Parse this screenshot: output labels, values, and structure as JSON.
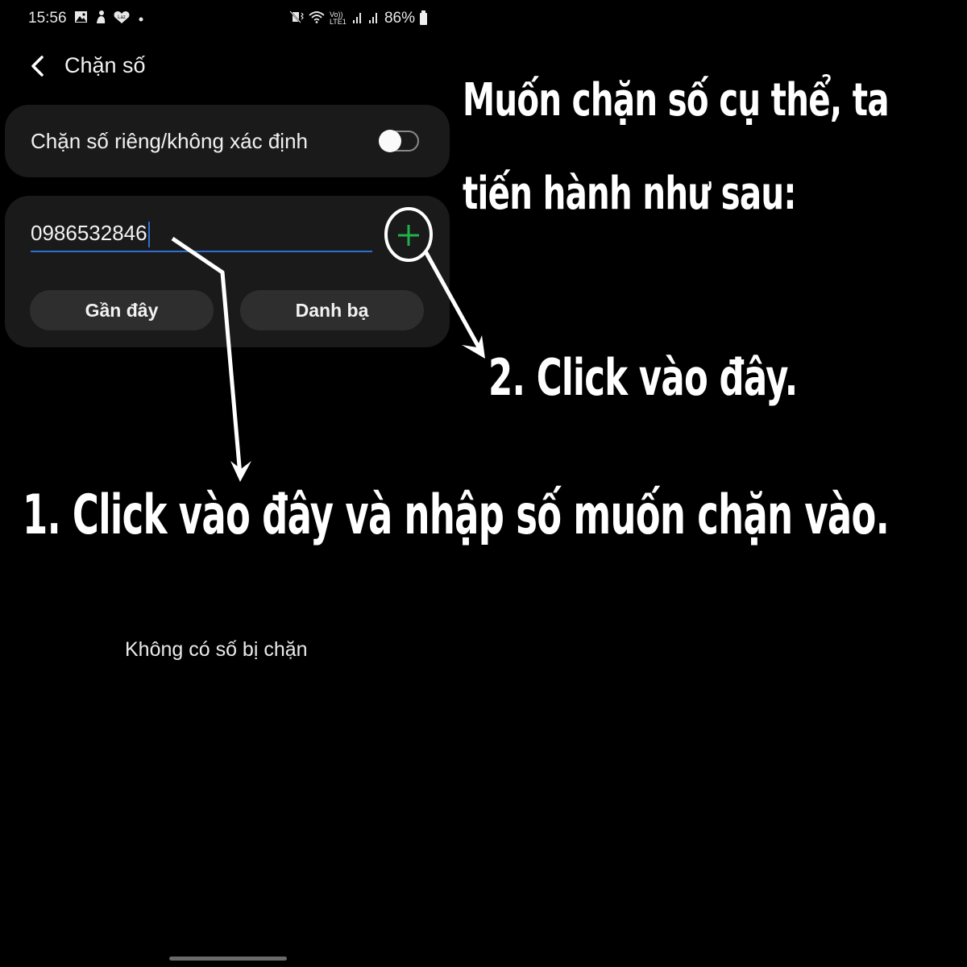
{
  "status_bar": {
    "time": "15:56",
    "notification_icons": [
      "gallery-icon",
      "app-icon",
      "lazada-icon",
      "dot-icon"
    ],
    "system_icons": [
      "vibrate-mute-icon",
      "wifi-icon",
      "volte-lte-icon",
      "signal-icon",
      "signal-icon-2"
    ],
    "volte_label": "Vo)) LTE1",
    "battery_percent": "86%"
  },
  "header": {
    "back_icon": "chevron-left-icon",
    "title": "Chặn số"
  },
  "private_block": {
    "label": "Chặn số riêng/không xác định",
    "toggle_on": false
  },
  "number_entry": {
    "value": "0986532846",
    "add_icon": "plus-icon",
    "accent_color": "#2f6fcf",
    "add_color": "#22b04a",
    "buttons": {
      "recent": "Gần đây",
      "contacts": "Danh bạ"
    }
  },
  "empty_state": "Không có số bị chặn",
  "annotations": {
    "intro_line1": "Muốn chặn số cụ thể, ta",
    "intro_line2": "tiến hành như sau:",
    "step2": "2. Click vào đây.",
    "step1": "1. Click vào đây và nhập số muốn chặn vào."
  }
}
